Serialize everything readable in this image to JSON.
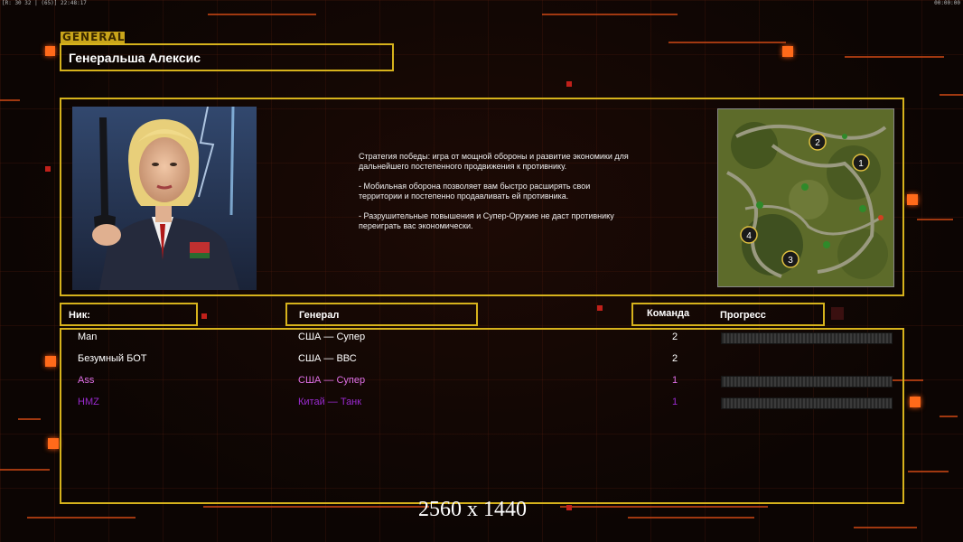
{
  "status_bar": {
    "left_text": "[R: 30 32 | (65)] 22:48:17",
    "right_text": "00:00:00"
  },
  "header": {
    "tag": "GENERAL",
    "general_name": "Генеральша Алексис"
  },
  "strategy": {
    "lines": [
      "Стратегия победы: игра от мощной обороны и развитие экономики для дальнейшего постепенного продвижения к противнику.",
      "- Мобильная оборона позволяет вам быстро расширять свои территории и постепенно продавливать ей противника.",
      "- Разрушительные повышения и Супер-Оружие не даст противнику переиграть вас экономически."
    ]
  },
  "minimap": {
    "markers": [
      "1",
      "2",
      "3",
      "4"
    ]
  },
  "table": {
    "headers": {
      "nick": "Ник:",
      "general": "Генерал",
      "team": "Команда",
      "progress": "Прогресс"
    },
    "rows": [
      {
        "nick": "Man",
        "general": "США — Супер",
        "team": "2",
        "color": "#ffffff",
        "show_progress": true
      },
      {
        "nick": "Безумный БОТ",
        "general": "США — ВВС",
        "team": "2",
        "color": "#ffffff",
        "show_progress": false
      },
      {
        "nick": "Ass",
        "general": "США — Супер",
        "team": "1",
        "color": "#e070e8",
        "show_progress": true
      },
      {
        "nick": "HMZ",
        "general": "Китай — Танк",
        "team": "1",
        "color": "#9a2ad0",
        "show_progress": true
      }
    ]
  },
  "watermark": "2560 x 1440",
  "colors": {
    "frame": "#d6b21c",
    "accent_orange": "#ff6a1a",
    "background": "#0c0503"
  }
}
